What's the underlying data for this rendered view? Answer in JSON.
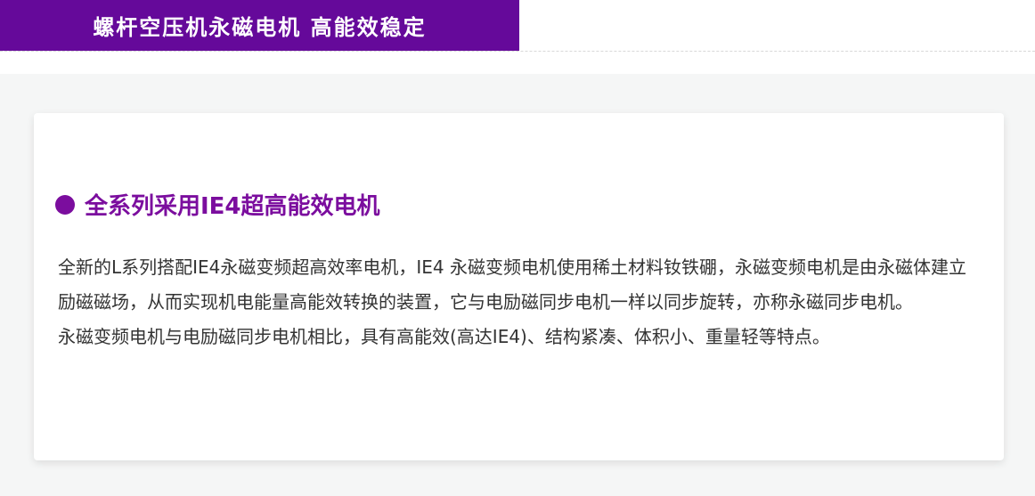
{
  "banner": {
    "title": "螺杆空压机永磁电机 高能效稳定",
    "background_color": "#65099a",
    "text_color": "#ffffff"
  },
  "card": {
    "heading": "全系列采用IE4超高能效电机",
    "heading_color": "#7b0d9e",
    "bullet_icon": "filled-circle",
    "paragraphs": {
      "p1": "全新的L系列搭配IE4永磁变频超高效率电机，IE4 永磁变频电机使用稀土材料钕铁硼，永磁变频电机是由永磁体建立励磁磁场，从而实现机电能量高能效转换的装置，它与电励磁同步电机一样以同步旋转，亦称永磁同步电机。",
      "p2": "永磁变频电机与电励磁同步电机相比，具有高能效(高达IE4)、结构紧凑、体积小、重量轻等特点。"
    },
    "text_color": "#333333"
  }
}
